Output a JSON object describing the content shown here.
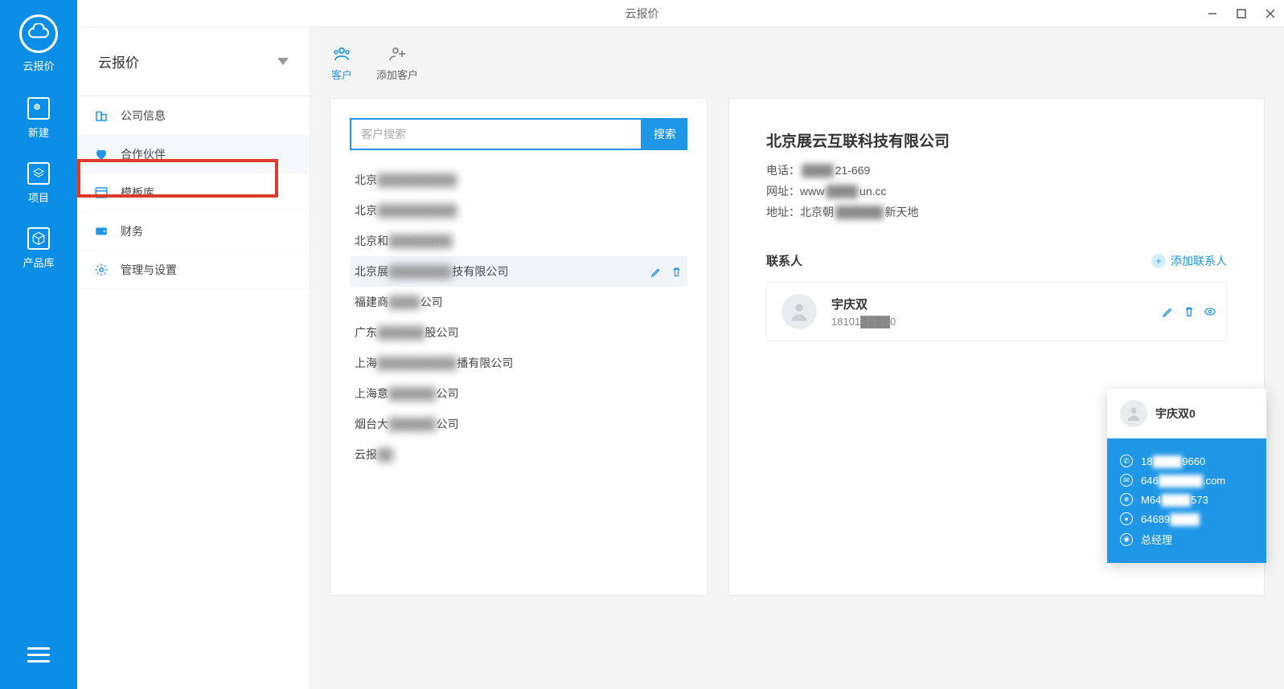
{
  "window": {
    "title": "云报价"
  },
  "rail": {
    "brand": "云报价",
    "items": [
      {
        "label": "新建"
      },
      {
        "label": "项目"
      },
      {
        "label": "产品库"
      }
    ]
  },
  "secnav": {
    "header": "云报价",
    "items": [
      {
        "label": "公司信息"
      },
      {
        "label": "合作伙伴"
      },
      {
        "label": "模板库"
      },
      {
        "label": "财务"
      },
      {
        "label": "管理与设置"
      }
    ]
  },
  "toolbar": {
    "customer": "客户",
    "add_customer": "添加客户"
  },
  "search": {
    "placeholder": "客户搜索",
    "button": "搜索"
  },
  "customers": [
    {
      "prefix": "北京",
      "rest": "██████████"
    },
    {
      "prefix": "北京",
      "rest": "██████████"
    },
    {
      "prefix": "北京和",
      "rest": "████████"
    },
    {
      "prefix": "北京展",
      "rest": "████████",
      "suffix": "技有限公司",
      "selected": true
    },
    {
      "prefix": "福建商",
      "rest": "████",
      "suffix": "公司"
    },
    {
      "prefix": "广东",
      "rest": "██████",
      "suffix": "股公司"
    },
    {
      "prefix": "上海",
      "rest": "██████████",
      "suffix": "播有限公司"
    },
    {
      "prefix": "上海意",
      "rest": "██████",
      "suffix": "公司"
    },
    {
      "prefix": "烟台大",
      "rest": "██████",
      "suffix": "公司"
    },
    {
      "prefix": "云报",
      "rest": "██"
    }
  ],
  "detail": {
    "company": "北京展云互联科技有限公司",
    "phone_label": "电话：",
    "phone_pre": "",
    "phone_blur": "████",
    "phone_post": "21-669",
    "url_label": "网址：www",
    "url_blur": "████",
    "url_post": "un.cc",
    "addr_label": "地址：北京朝",
    "addr_blur": "██████",
    "addr_post": "新天地"
  },
  "contacts": {
    "label": "联系人",
    "add": "添加联系人",
    "items": [
      {
        "name": "宇庆双",
        "phone_pre": "18101",
        "phone_blur": "████",
        "phone_post": "0"
      }
    ]
  },
  "popup": {
    "name": "宇庆双0",
    "rows": [
      {
        "icon": "phone",
        "pre": "18",
        "blur": "████",
        "post": "9660"
      },
      {
        "icon": "email",
        "pre": "646",
        "blur": "██████",
        "post": ".com"
      },
      {
        "icon": "wechat",
        "pre": "M64",
        "blur": "████",
        "post": "573"
      },
      {
        "icon": "qq",
        "pre": "64689",
        "blur": "████",
        "post": ""
      },
      {
        "icon": "role",
        "pre": "总经理",
        "blur": "",
        "post": ""
      }
    ]
  }
}
